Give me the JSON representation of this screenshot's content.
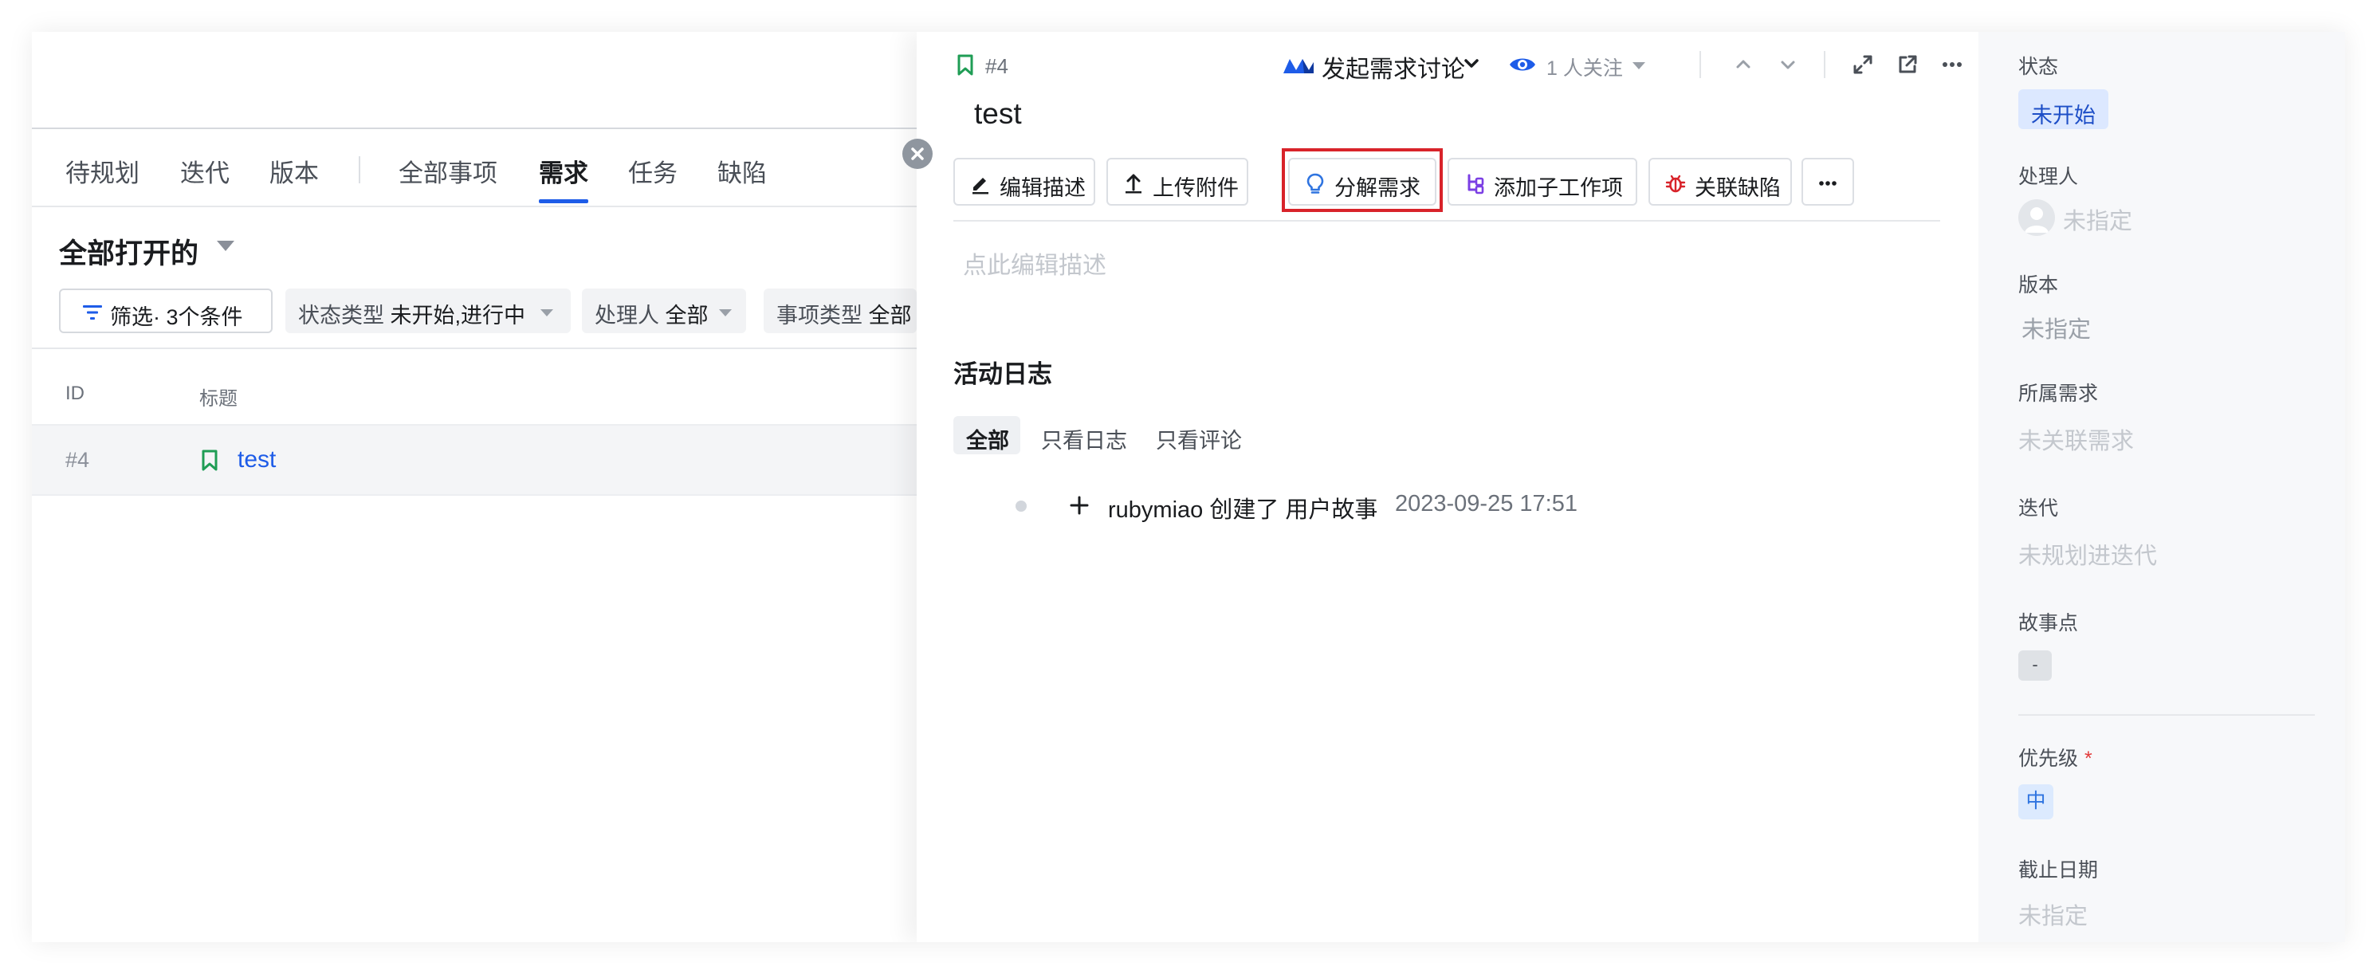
{
  "list": {
    "tabs": [
      {
        "label": "待规划"
      },
      {
        "label": "迭代"
      },
      {
        "label": "版本"
      },
      {
        "label": "全部事项"
      },
      {
        "label": "需求"
      },
      {
        "label": "任务"
      },
      {
        "label": "缺陷"
      }
    ],
    "active_tab": "需求",
    "view_title": "全部打开的",
    "filter_label": "筛选· 3个条件",
    "chips": [
      {
        "label": "状态类型",
        "value": "未开始,进行中"
      },
      {
        "label": "处理人",
        "value": "全部"
      },
      {
        "label": "事项类型",
        "value": "全部"
      }
    ],
    "columns": {
      "id": "ID",
      "title": "标题"
    },
    "rows": [
      {
        "id": "#4",
        "title": "test"
      }
    ]
  },
  "detail": {
    "id": "#4",
    "title": "test",
    "discuss_label": "发起需求讨论",
    "follow_text": "1 人关注",
    "actions": [
      {
        "label": "编辑描述",
        "icon": "edit-icon"
      },
      {
        "label": "上传附件",
        "icon": "upload-icon"
      },
      {
        "label": "分解需求",
        "icon": "lightbulb-icon"
      },
      {
        "label": "添加子工作项",
        "icon": "subtask-icon"
      },
      {
        "label": "关联缺陷",
        "icon": "bug-icon"
      }
    ],
    "desc_placeholder": "点此编辑描述",
    "activity_title": "活动日志",
    "filters": [
      {
        "label": "全部"
      },
      {
        "label": "只看日志"
      },
      {
        "label": "只看评论"
      }
    ],
    "log": {
      "text": "rubymiao 创建了 用户故事",
      "time": "2023-09-25 17:51"
    }
  },
  "props": {
    "status": {
      "label": "状态",
      "value": "未开始"
    },
    "assignee": {
      "label": "处理人",
      "value": "未指定"
    },
    "version": {
      "label": "版本",
      "value": "未指定"
    },
    "parent": {
      "label": "所属需求",
      "value": "未关联需求"
    },
    "iteration": {
      "label": "迭代",
      "value": "未规划进迭代"
    },
    "story_points": {
      "label": "故事点",
      "value": "-"
    },
    "priority": {
      "label": "优先级",
      "required": "*",
      "value": "中"
    },
    "due_date": {
      "label": "截止日期",
      "value": "未指定"
    }
  },
  "colors": {
    "accent": "#1e5ce8",
    "highlight_box": "#d8232a",
    "bookmark_green": "#1f9d55",
    "bug_red": "#d8232a",
    "subtask_purple": "#7b3fe4"
  }
}
